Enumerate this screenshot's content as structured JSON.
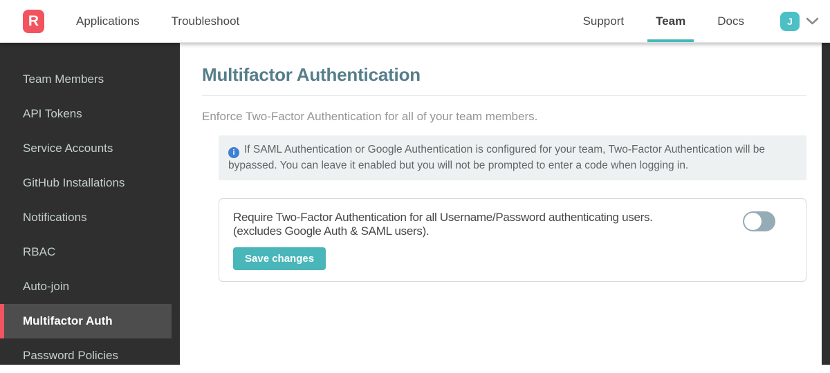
{
  "header": {
    "logo": {
      "letter": "R",
      "icon": "rollbar-logo-icon"
    },
    "nav_left": [
      {
        "label": "Applications"
      },
      {
        "label": "Troubleshoot"
      }
    ],
    "nav_right": [
      {
        "label": "Support"
      },
      {
        "label": "Team"
      },
      {
        "label": "Docs"
      }
    ],
    "active_tab": "Team",
    "avatar_initial": "J",
    "avatar_menu_icon": "chevron-down-icon"
  },
  "sidebar": {
    "items": [
      {
        "label": "Team Members"
      },
      {
        "label": "API Tokens"
      },
      {
        "label": "Service Accounts"
      },
      {
        "label": "GitHub Installations"
      },
      {
        "label": "Notifications"
      },
      {
        "label": "RBAC"
      },
      {
        "label": "Auto-join"
      },
      {
        "label": "Multifactor Auth"
      },
      {
        "label": "Password Policies"
      }
    ],
    "active_item": "Multifactor Auth"
  },
  "main": {
    "title": "Multifactor Authentication",
    "description": "Enforce Two-Factor Authentication for all of your team members.",
    "info_note": {
      "icon": "info-circle-icon",
      "icon_glyph": "i",
      "text": "If SAML Authentication or Google Authentication is configured for your team, Two-Factor Authentication will be bypassed. You can leave it enabled but you will not be prompted to enter a code when logging in."
    },
    "setting_card": {
      "line1": "Require Two-Factor Authentication for all Username/Password authenticating users.",
      "line2": "(excludes Google Auth & SAML users).",
      "toggle_state": "off",
      "save_label": "Save changes"
    }
  },
  "colors": {
    "brand_red": "#f3535f",
    "accent_teal": "#45b6bc",
    "avatar_teal": "#4cc0c5",
    "heading_slate": "#567e8a",
    "info_icon_blue": "#3f7fd6",
    "toggle_off_pill": "#95abb5",
    "sidebar_bg": "#2f2f2f",
    "sidebar_active_bg": "#4d4d4d"
  }
}
